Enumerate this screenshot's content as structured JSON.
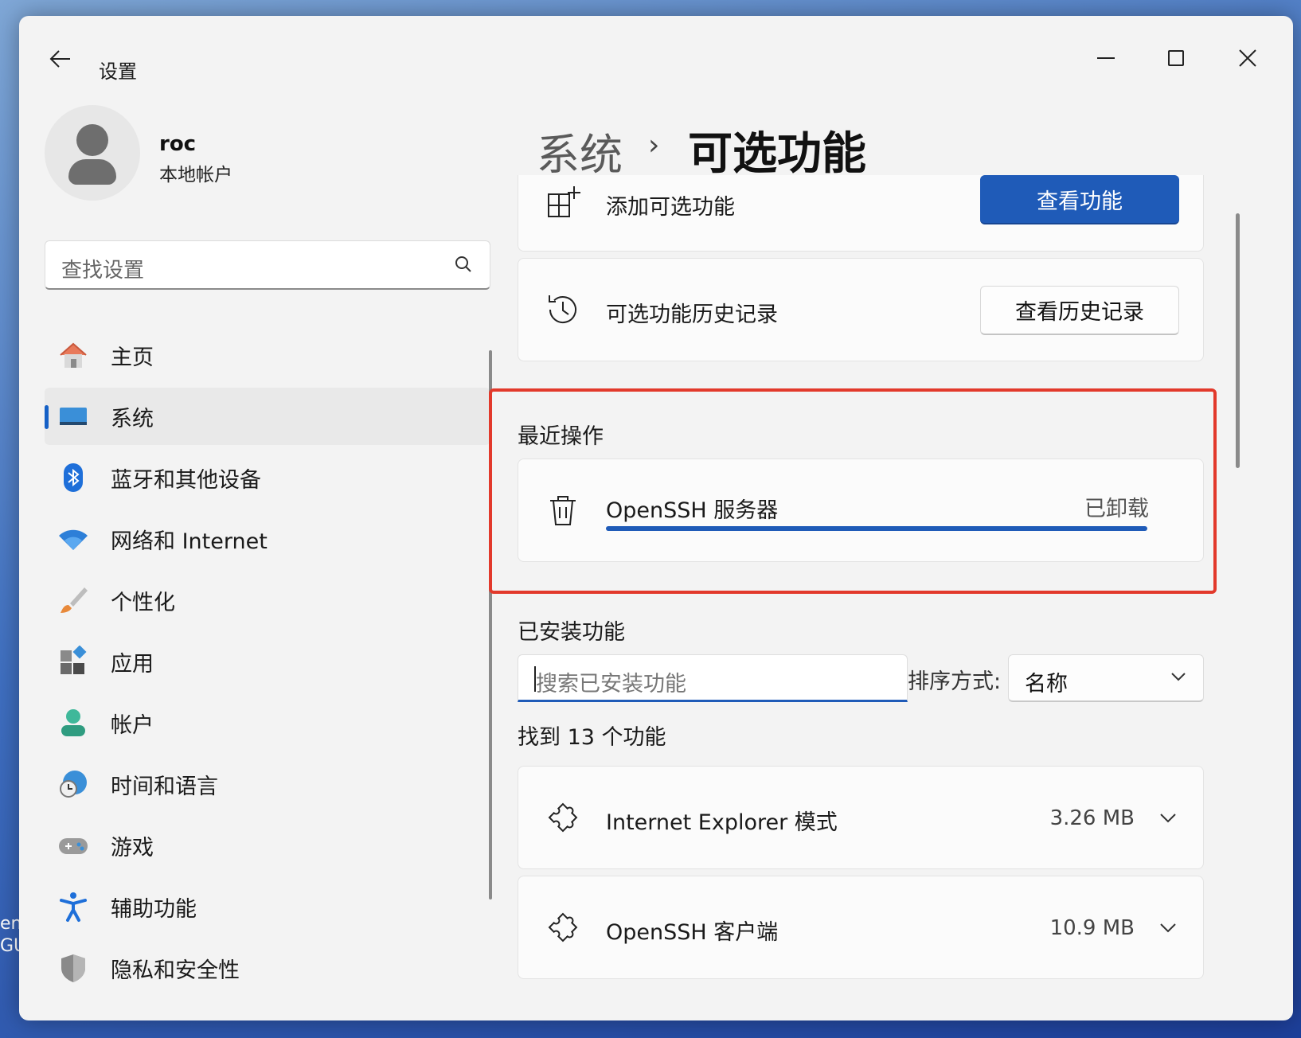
{
  "window": {
    "title": "设置",
    "minimize_icon": "minimize-icon",
    "maximize_icon": "maximize-icon",
    "close_icon": "close-icon"
  },
  "user": {
    "name": "roc",
    "account_type": "本地帐户"
  },
  "search": {
    "placeholder": "查找设置"
  },
  "nav": {
    "items": [
      {
        "label": "主页",
        "icon": "home-icon",
        "active": false
      },
      {
        "label": "系统",
        "icon": "system-icon",
        "active": true
      },
      {
        "label": "蓝牙和其他设备",
        "icon": "bluetooth-icon",
        "active": false
      },
      {
        "label": "网络和 Internet",
        "icon": "wifi-icon",
        "active": false
      },
      {
        "label": "个性化",
        "icon": "brush-icon",
        "active": false
      },
      {
        "label": "应用",
        "icon": "apps-icon",
        "active": false
      },
      {
        "label": "帐户",
        "icon": "account-icon",
        "active": false
      },
      {
        "label": "时间和语言",
        "icon": "globe-clock-icon",
        "active": false
      },
      {
        "label": "游戏",
        "icon": "gamepad-icon",
        "active": false
      },
      {
        "label": "辅助功能",
        "icon": "accessibility-icon",
        "active": false
      },
      {
        "label": "隐私和安全性",
        "icon": "shield-icon",
        "active": false
      }
    ]
  },
  "breadcrumb": {
    "parent": "系统",
    "separator": "›",
    "current": "可选功能"
  },
  "add_feature": {
    "label": "添加可选功能",
    "button": "查看功能"
  },
  "history": {
    "label": "可选功能历史记录",
    "button": "查看历史记录"
  },
  "recent": {
    "title": "最近操作",
    "item_name": "OpenSSH 服务器",
    "item_status": "已卸载",
    "progress": 1.0
  },
  "installed": {
    "title": "已安装功能",
    "search_placeholder": "搜索已安装功能",
    "sort_label": "排序方式:",
    "sort_value": "名称",
    "count_text": "找到 13 个功能",
    "items": [
      {
        "name": "Internet Explorer 模式",
        "size": "3.26 MB"
      },
      {
        "name": "OpenSSH 客户端",
        "size": "10.9 MB"
      }
    ]
  },
  "colors": {
    "accent": "#1f5bb8",
    "highlight_border": "#e2392b"
  }
}
